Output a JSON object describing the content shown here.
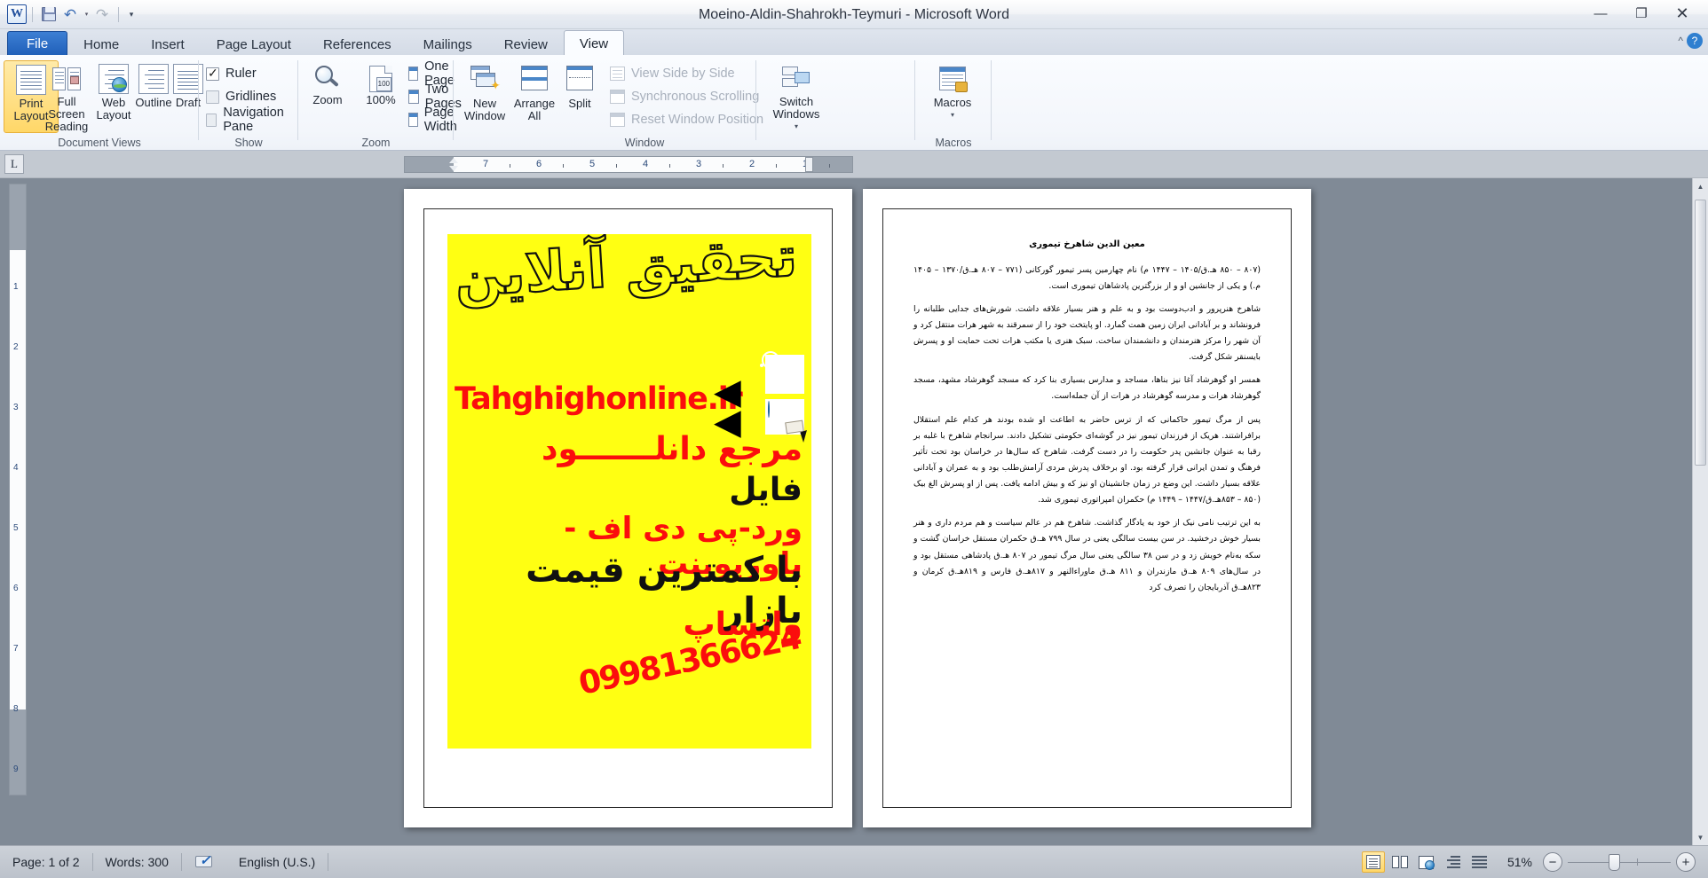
{
  "window": {
    "title": "Moeino-Aldin-Shahrokh-Teymuri  -  Microsoft Word",
    "minimize_label": "—",
    "restore_label": "❐",
    "close_label": "✕",
    "help_label": "?",
    "collapse_ribbon_label": "^"
  },
  "quick_access": {
    "word_logo": "W",
    "save_label": "save-icon",
    "undo_label": "↶",
    "undo_dropdown": "▾",
    "redo_label": "↷",
    "customize_label": "▾"
  },
  "tabs": [
    {
      "label": "File",
      "id": "file"
    },
    {
      "label": "Home",
      "id": "home"
    },
    {
      "label": "Insert",
      "id": "insert"
    },
    {
      "label": "Page Layout",
      "id": "page-layout"
    },
    {
      "label": "References",
      "id": "references"
    },
    {
      "label": "Mailings",
      "id": "mailings"
    },
    {
      "label": "Review",
      "id": "review"
    },
    {
      "label": "View",
      "id": "view"
    }
  ],
  "active_tab": "View",
  "ribbon": {
    "groups": [
      {
        "id": "document-views",
        "label": "Document Views"
      },
      {
        "id": "show",
        "label": "Show"
      },
      {
        "id": "zoom",
        "label": "Zoom"
      },
      {
        "id": "window",
        "label": "Window"
      },
      {
        "id": "macros",
        "label": "Macros"
      }
    ],
    "document_views": {
      "print_layout": "Print\nLayout",
      "print_layout_l1": "Print",
      "print_layout_l2": "Layout",
      "full_screen_l1": "Full Screen",
      "full_screen_l2": "Reading",
      "web_layout_l1": "Web",
      "web_layout_l2": "Layout",
      "outline": "Outline",
      "draft": "Draft"
    },
    "show": {
      "ruler": "Ruler",
      "ruler_checked": true,
      "gridlines": "Gridlines",
      "gridlines_checked": false,
      "navigation_pane": "Navigation Pane",
      "navigation_pane_checked": false
    },
    "zoom": {
      "zoom": "Zoom",
      "one_hundred": "100%",
      "one_hundred_badge": "100",
      "one_page": "One Page",
      "two_pages": "Two Pages",
      "page_width": "Page Width"
    },
    "window": {
      "new_window_l1": "New",
      "new_window_l2": "Window",
      "arrange_all_l1": "Arrange",
      "arrange_all_l2": "All",
      "split": "Split",
      "view_side_by_side": "View Side by Side",
      "synchronous_scrolling": "Synchronous Scrolling",
      "reset_window_position": "Reset Window Position",
      "switch_windows_l1": "Switch",
      "switch_windows_l2": "Windows",
      "switch_windows_caret": "▾"
    },
    "macros": {
      "macros": "Macros",
      "macros_caret": "▾"
    }
  },
  "ruler": {
    "tab_selector": "L",
    "h_numbers": [
      "7",
      "6",
      "5",
      "4",
      "3",
      "2",
      "1"
    ],
    "v_numbers": [
      "1",
      "2",
      "3",
      "4",
      "5",
      "6",
      "7",
      "8",
      "9"
    ]
  },
  "document": {
    "page1": {
      "ad": {
        "headline": "تحقیق آنلاین",
        "url": "Tahghighonline.ir",
        "line1": "مرجع دانلـــــــود",
        "line2": "فایل",
        "line3": "ورد-پی دی اف - پاورپوینت",
        "line4": "با کمترین قیمت بازار",
        "whatsapp_label": "واتساپ",
        "phone": "09981366624",
        "arrow_glyph": "➤",
        "instagram_icon": "instagram-icon",
        "website_icon": "website-icon",
        "bg_color": "#ffff12",
        "red_color": "#fb0d0d"
      }
    },
    "page2": {
      "title": "معین الدین شاهرخ تیموری",
      "paragraphs": [
        "(۸۰۷ – ۸۵۰ هـ.ق/۱۴۰۵ – ۱۴۴۷ م) نام چهارمین پسر تیمور گورکانی (۷۷۱ – ۸۰۷ هـ.ق/۱۳۷۰ – ۱۴۰۵ م.) و یکی از جانشین او و از بزرگترین پادشاهان تیموری است.",
        "شاهرخ هنرپرور و ادب‌دوست بود و به علم و هنر بسیار علاقه داشت. شورش‌های جدایی طلبانه را فرونشاند و بر آبادانی ایران زمین همت گمارد. او پایتخت خود را از سمرقند به شهر هرات منتقل کرد و آن شهر را مرکز هنرمندان و دانشمندان ساخت. سبک هنری یا مکتب هرات تحت حمایت او و پسرش بایسنقر شکل گرفت.",
        "همسر او گوهرشاد آغا نیز بناها، مساجد و مدارس بسیاری بنا کرد که مسجد گوهرشاد مشهد، مسجد گوهرشاد هرات و مدرسه گوهرشاد در هرات از آن جمله‌است.",
        "پس از مرگ تیمور حاکمانی که از ترس حاضر به اطاعت او شده بودند هر کدام علم استقلال برافراشتند. هریک از فرزندان تیمور نیز در گوشه‌ای حکومتی تشکیل دادند. سرانجام شاهرخ با غلبه بر رقبا به عنوان جانشین پدر حکومت را در دست گرفت. شاهرخ که سال‌ها در خراسان بود تحت تأثیر فرهنگ و تمدن ایرانی قرار گرفته بود. او برخلاف پدرش مردی آرامش‌طلب بود و به عمران و آبادانی علاقه بسیار داشت. این وضع در زمان جانشینان او نیز که و بیش ادامه یافت. پس از او پسرش الغ بیک (۸۵۰ – ۸۵۳هـ.ق/۱۴۴۷ – ۱۴۴۹ م) حکمران امپراتوری تیموری شد.",
        "به این ترتیب نامی نیک از خود به یادگار گذاشت. شاهرخ هم در عالم سیاست و هم مردم داری و هنر بسیار خوش درخشید. در سن بیست سالگی یعنی در سال ۷۹۹ هـ.ق حکمران مستقل خراسان گشت و سکه به‌نام خویش زد و در سن ۳۸ سالگی یعنی سال مرگ تیمور در ۸۰۷ هـ.ق پادشاهی مستقل بود و در سال‌های ۸۰۹ هـ.ق مازندران و ۸۱۱ هـ.ق ماوراءالنهر و ۸۱۷هـ.ق فارس و ۸۱۹هـ.ق کرمان و ۸۲۳هـ.ق آذربایجان را تصرف کرد"
      ]
    }
  },
  "status_bar": {
    "page_indicator": "Page: 1 of 2",
    "word_count": "Words: 300",
    "proofing_icon": "spell-check-icon",
    "language": "English (U.S.)",
    "zoom_percent": "51%",
    "zoom_out_label": "−",
    "zoom_in_label": "+",
    "view_buttons": [
      {
        "id": "print-layout",
        "name": "print-layout-view-button",
        "active": true
      },
      {
        "id": "full-screen-reading",
        "name": "full-screen-reading-view-button",
        "active": false
      },
      {
        "id": "web-layout",
        "name": "web-layout-view-button",
        "active": false
      },
      {
        "id": "outline",
        "name": "outline-view-button",
        "active": false
      },
      {
        "id": "draft",
        "name": "draft-view-button",
        "active": false
      }
    ]
  }
}
